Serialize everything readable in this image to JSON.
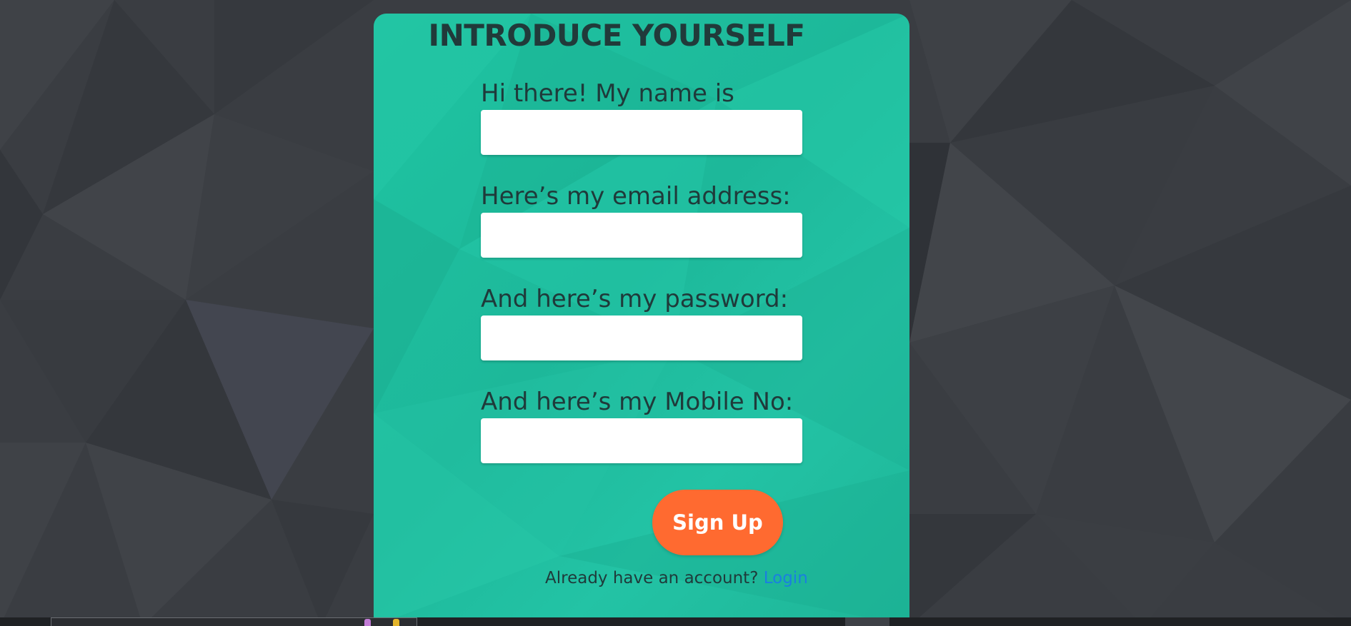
{
  "form": {
    "title": "INTRODUCE YOURSELF",
    "fields": [
      {
        "label": "Hi there! My name is",
        "value": "",
        "type": "text"
      },
      {
        "label": "Here’s my email address:",
        "value": "",
        "type": "email"
      },
      {
        "label": "And here’s my password:",
        "value": "",
        "type": "password"
      },
      {
        "label": "And here’s my Mobile No:",
        "value": "",
        "type": "tel"
      }
    ],
    "submit_label": "Sign Up",
    "login_prompt": "Already have an account?",
    "login_link": "Login"
  },
  "colors": {
    "page_background": "#3a3d42",
    "card": "#1fbf9f",
    "button": "#ff6a30",
    "link": "#1a7fe0",
    "text": "#1f3a3a"
  }
}
